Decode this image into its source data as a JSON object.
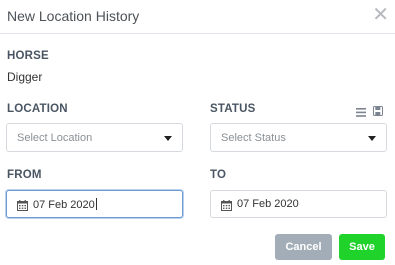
{
  "dialog": {
    "title": "New Location History",
    "close_icon": "close-icon"
  },
  "horse": {
    "label": "HORSE",
    "value": "Digger"
  },
  "location": {
    "label": "LOCATION",
    "placeholder": "Select Location"
  },
  "status": {
    "label": "STATUS",
    "placeholder": "Select Status",
    "icons": [
      "list-icon",
      "save-disk-icon"
    ]
  },
  "from": {
    "label": "FROM",
    "value": "07 Feb 2020"
  },
  "to": {
    "label": "TO",
    "value": "07 Feb 2020"
  },
  "actions": {
    "cancel_label": "Cancel",
    "save_label": "Save"
  },
  "colors": {
    "save": "#1fd32a",
    "cancel": "#a2adb7",
    "focus_border": "#6f9bd1"
  }
}
